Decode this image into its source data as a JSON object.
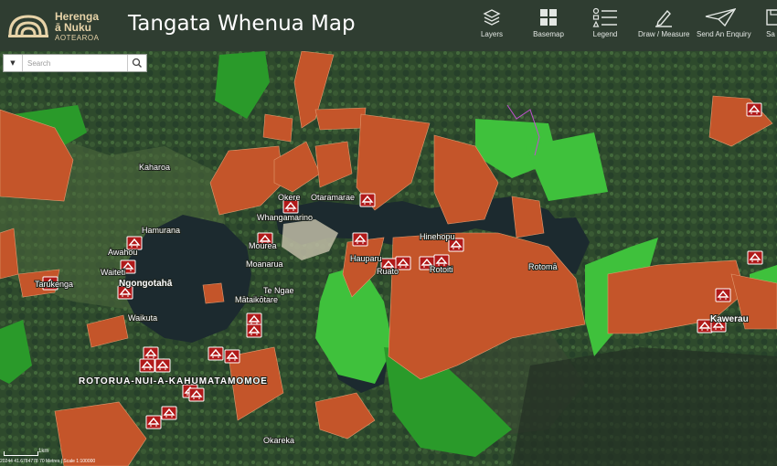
{
  "header": {
    "logo": {
      "name": "Herenga\nā Nuku",
      "subtitle": "AOTEAROA"
    },
    "title": "Tangata Whenua Map",
    "tools": [
      {
        "label": "Layers",
        "icon": "layers-icon"
      },
      {
        "label": "Basemap",
        "icon": "basemap-grid-icon"
      },
      {
        "label": "Legend",
        "icon": "legend-list-icon"
      },
      {
        "label": "Draw / Measure",
        "icon": "pencil-ruler-icon"
      },
      {
        "label": "Send An Enquiry",
        "icon": "paper-plane-icon"
      },
      {
        "label": "Sa",
        "icon": "save-icon"
      }
    ]
  },
  "search": {
    "placeholder": "Search",
    "value": "",
    "dropdown_icon": "caret-down-icon",
    "button_icon": "magnifier-icon"
  },
  "map": {
    "colors": {
      "water": "#1b2a30",
      "maori_freehold": "#c4552a",
      "reserve_light": "#3fc13c",
      "reserve_dark": "#2a9a2a",
      "marae_marker": "#b11a1a"
    },
    "place_labels": [
      "Kaharoa",
      "Hamurana",
      "Awahou",
      "Waiteti",
      "Tarukenga",
      "Ngongotahā",
      "Waikuta",
      "ROTORUA-NUI-A-KAHUMATAMOMOE",
      "Okareka",
      "Okere",
      "Otaramarae",
      "Whangamarino",
      "Mourea",
      "Moanarua",
      "Te Ngae",
      "Mātaikōtare",
      "Hauparu",
      "Ruato",
      "Rotoiti",
      "Hinehopu",
      "Rotomā",
      "Kawerau"
    ],
    "marae_icon": "marae-house-icon"
  },
  "status_bar": {
    "coordinates": "20244 41.6784778 70 Metres | Scale 1:100000",
    "scale_label": "1km"
  }
}
